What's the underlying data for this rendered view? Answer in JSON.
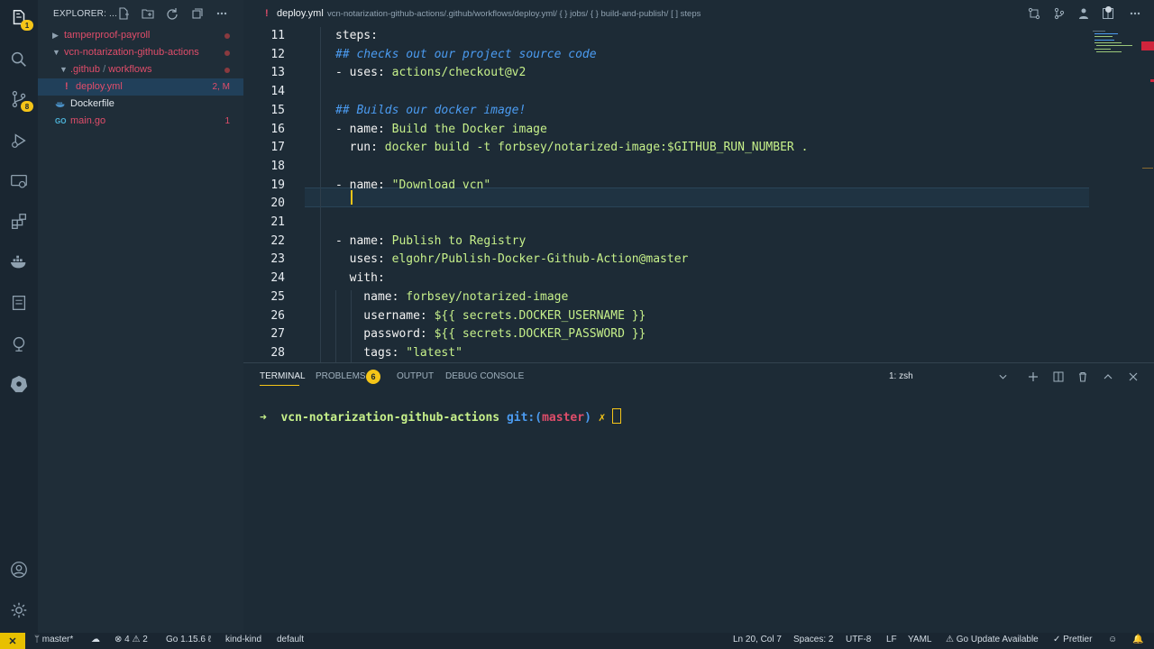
{
  "colors": {
    "accent": "#f5c518",
    "background": "#1d2b36",
    "sidebar": "#1f2d38",
    "selected": "#21405a",
    "modified": "#e04d6a",
    "comment": "#4b9bf0",
    "string": "#c6f08a"
  },
  "activity_bar": {
    "explorer_badge": "1",
    "scm_badge": "8",
    "icons": [
      "files-icon",
      "search-icon",
      "source-control-icon",
      "run-debug-icon",
      "remote-explorer-icon",
      "extensions-icon",
      "docker-icon",
      "notes-icon",
      "gitlens-icon",
      "kubernetes-icon",
      "account-icon",
      "settings-gear-icon"
    ]
  },
  "sidebar": {
    "title": "EXPLORER: ...",
    "tree": [
      {
        "label": "tamperproof-payroll",
        "badge": ""
      },
      {
        "label": "vcn-notarization-github-actions",
        "badge": ""
      },
      {
        "label": ".github",
        "label2": "workflows",
        "badge": ""
      },
      {
        "label": "deploy.yml",
        "badge": "2, M"
      },
      {
        "label": "Dockerfile",
        "badge": ""
      },
      {
        "label": "main.go",
        "badge": "1"
      }
    ]
  },
  "tab": {
    "filename": "deploy.yml",
    "breadcrumb": "vcn-notarization-github-actions/.github/workflows/deploy.yml/ { } jobs/ { } build-and-publish/ [ ] steps"
  },
  "editor": {
    "lines": [
      {
        "n": "11",
        "parts": [
          {
            "t": "steps:",
            "c": "k"
          }
        ]
      },
      {
        "n": "12",
        "parts": [
          {
            "t": "## checks out our project source code",
            "c": "c"
          }
        ]
      },
      {
        "n": "13",
        "parts": [
          {
            "t": "- uses: ",
            "c": "k"
          },
          {
            "t": "actions/checkout@v2",
            "c": "v"
          }
        ]
      },
      {
        "n": "14",
        "parts": []
      },
      {
        "n": "15",
        "parts": [
          {
            "t": "## Builds our docker image!",
            "c": "c"
          }
        ]
      },
      {
        "n": "16",
        "parts": [
          {
            "t": "- name: ",
            "c": "k"
          },
          {
            "t": "Build the Docker image",
            "c": "v"
          }
        ]
      },
      {
        "n": "17",
        "parts": [
          {
            "t": "  run: ",
            "c": "k"
          },
          {
            "t": "docker build -t forbsey/notarized-image:$GITHUB_RUN_NUMBER .",
            "c": "v"
          }
        ]
      },
      {
        "n": "18",
        "parts": []
      },
      {
        "n": "19",
        "parts": [
          {
            "t": "- name: ",
            "c": "k"
          },
          {
            "t": "\"Download vcn\"",
            "c": "v"
          }
        ]
      },
      {
        "n": "20",
        "parts": []
      },
      {
        "n": "21",
        "parts": []
      },
      {
        "n": "22",
        "parts": [
          {
            "t": "- name: ",
            "c": "k"
          },
          {
            "t": "Publish to Registry",
            "c": "v"
          }
        ]
      },
      {
        "n": "23",
        "parts": [
          {
            "t": "  uses: ",
            "c": "k"
          },
          {
            "t": "elgohr/Publish-Docker-Github-Action@master",
            "c": "v"
          }
        ]
      },
      {
        "n": "24",
        "parts": [
          {
            "t": "  with:",
            "c": "k"
          }
        ]
      },
      {
        "n": "25",
        "parts": [
          {
            "t": "    name: ",
            "c": "k"
          },
          {
            "t": "forbsey/notarized-image",
            "c": "v"
          }
        ]
      },
      {
        "n": "26",
        "parts": [
          {
            "t": "    username: ",
            "c": "k"
          },
          {
            "t": "${{ secrets.DOCKER_USERNAME }}",
            "c": "v"
          }
        ]
      },
      {
        "n": "27",
        "parts": [
          {
            "t": "    password: ",
            "c": "k"
          },
          {
            "t": "${{ secrets.DOCKER_PASSWORD }}",
            "c": "v"
          }
        ]
      },
      {
        "n": "28",
        "parts": [
          {
            "t": "    tags: ",
            "c": "k"
          },
          {
            "t": "\"latest\"",
            "c": "v"
          }
        ]
      }
    ]
  },
  "panel": {
    "tabs": {
      "terminal": "TERMINAL",
      "problems": "PROBLEMS",
      "problems_count": "6",
      "output": "OUTPUT",
      "debug": "DEBUG CONSOLE"
    },
    "shell_select": "1: zsh",
    "terminal": {
      "arrow": "➜",
      "dir": "vcn-notarization-github-actions",
      "git": "git:(",
      "branch": "master",
      ")": ")",
      "dirty": "✗"
    }
  },
  "status": {
    "branch": "master*",
    "errors": "4",
    "warnings": "2",
    "go_version": "Go 1.15.6",
    "kube_context": "kind-kind",
    "namespace": "default",
    "position": "Ln 20, Col 7",
    "spaces": "Spaces: 2",
    "encoding": "UTF-8",
    "eol": "LF",
    "language": "YAML",
    "go_update": "Go Update Available",
    "prettier": "Prettier"
  }
}
